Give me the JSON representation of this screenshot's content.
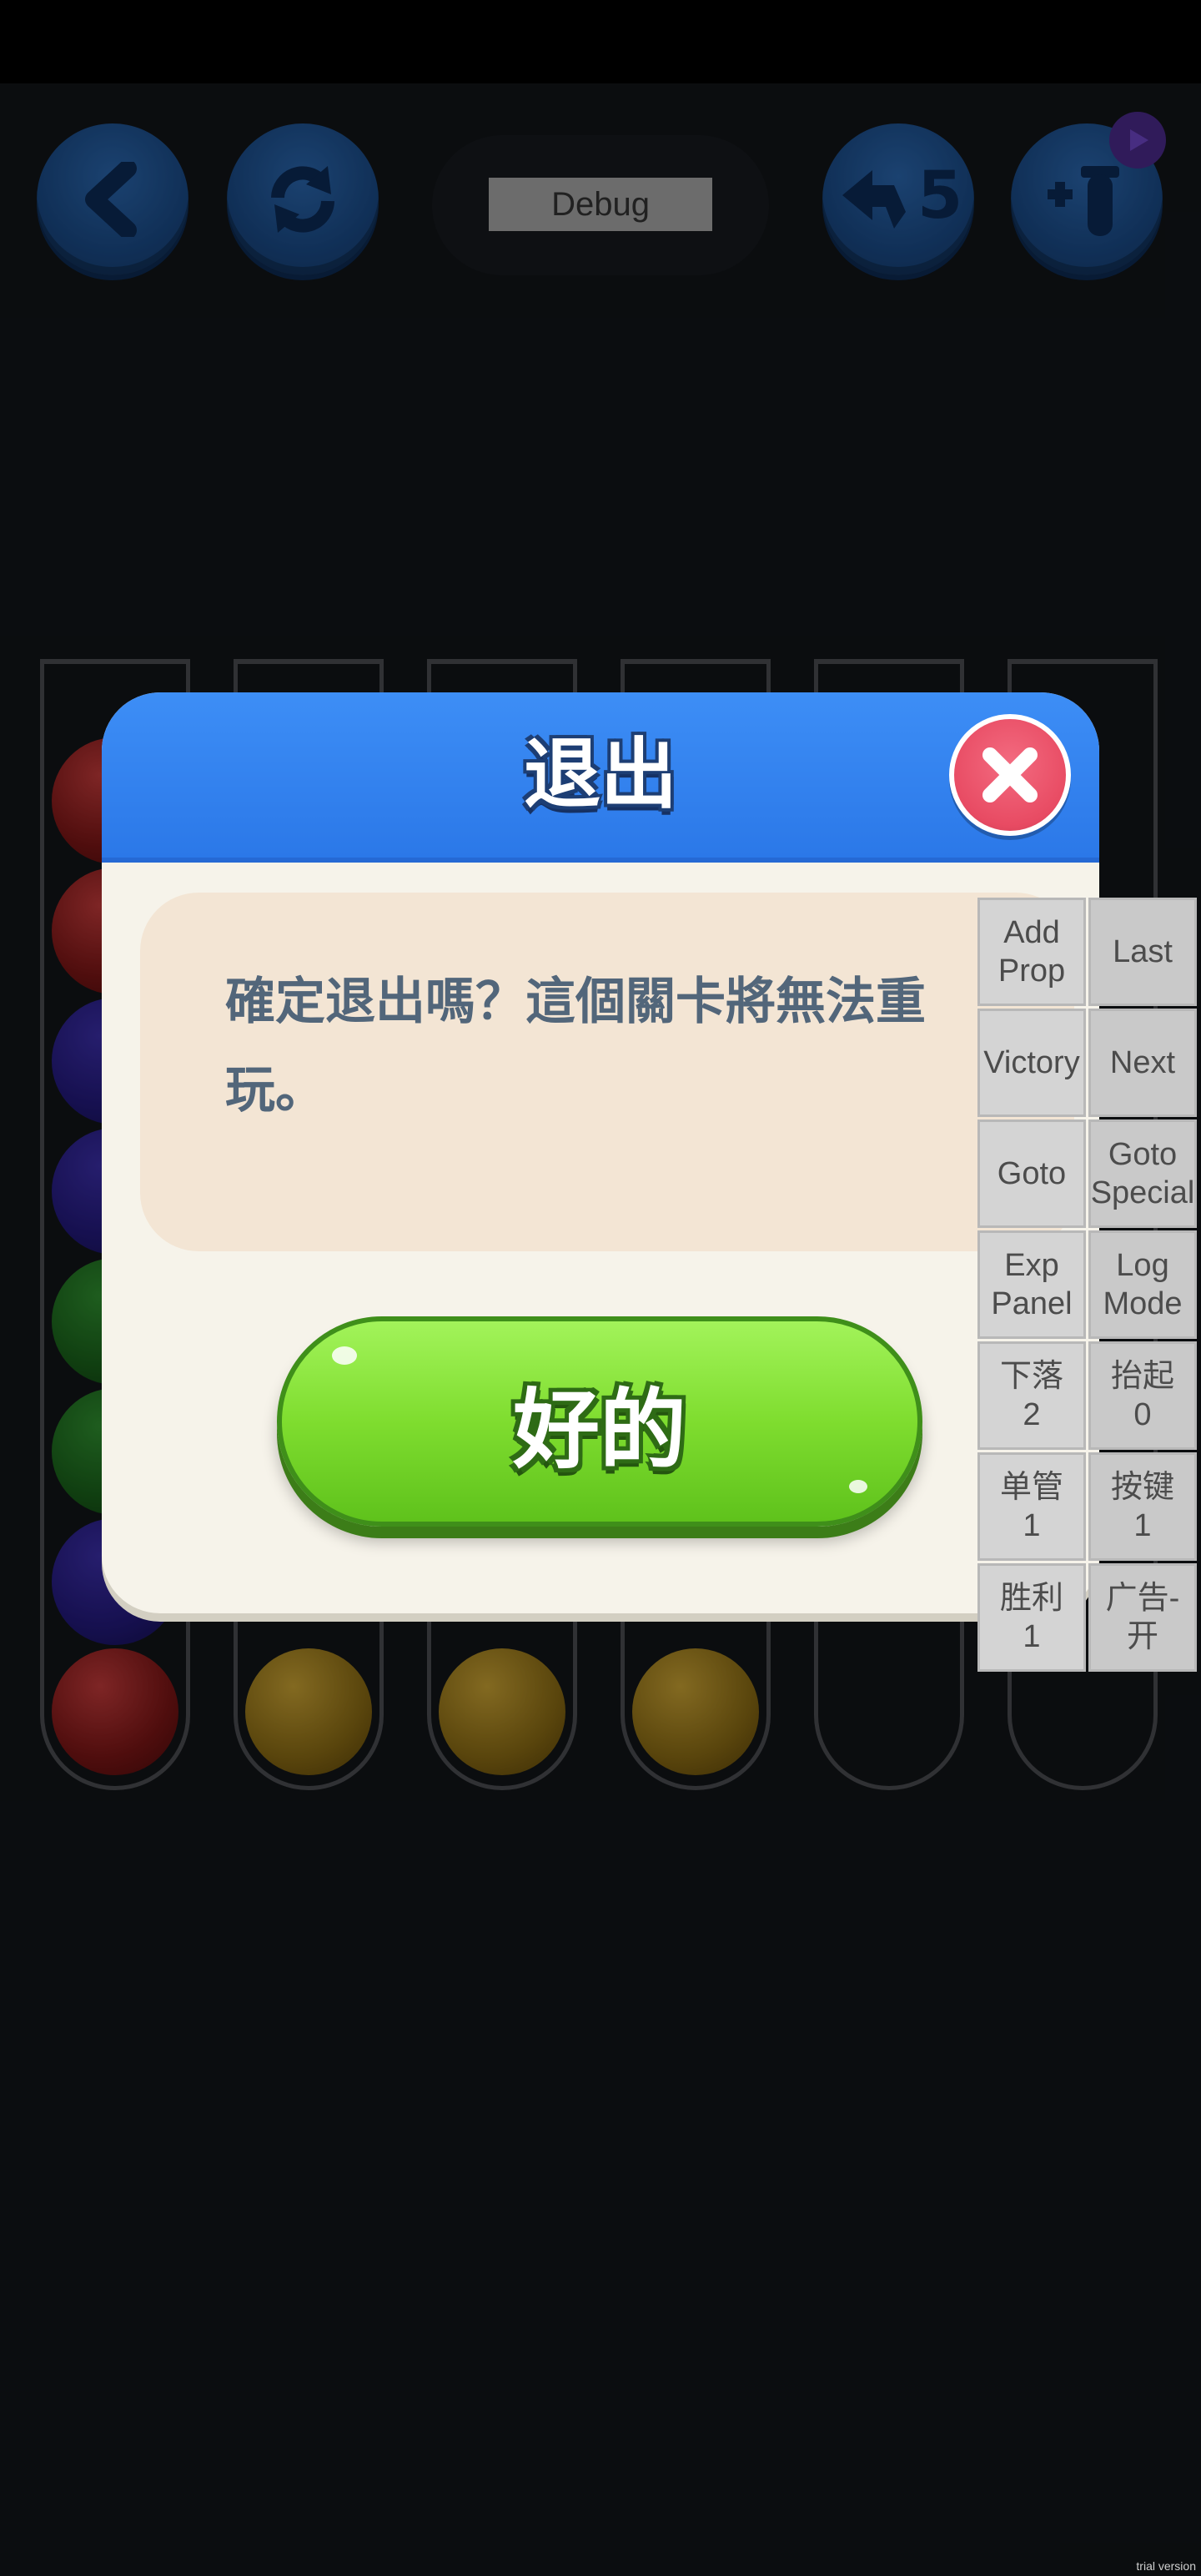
{
  "top_bar": {
    "back_icon": "chevron-left-icon",
    "restart_icon": "refresh-icon",
    "debug_label": "Debug",
    "undo_icon": "undo-arrow-icon",
    "undo_count": "5",
    "add_tube_icon": "add-tube-icon",
    "ad_badge_icon": "play-icon"
  },
  "tubes": [
    {
      "balls": [
        "red",
        "red",
        "blue",
        "blue",
        "green",
        "green",
        "blue",
        "red"
      ]
    },
    {
      "balls": [
        "yellow"
      ]
    },
    {
      "balls": [
        "yellow"
      ]
    },
    {
      "balls": [
        "yellow"
      ]
    },
    {
      "balls": []
    },
    {
      "balls": []
    }
  ],
  "dialog": {
    "title": "退出",
    "message": "確定退出嗎？這個關卡將無法重玩。",
    "ok_label": "好的",
    "close_icon": "close-icon"
  },
  "debug_panel": {
    "buttons": [
      [
        "Add\nProp",
        "Last"
      ],
      [
        "Victory",
        "Next"
      ],
      [
        "Goto",
        "Goto\nSpecial"
      ],
      [
        "Exp\nPanel",
        "Log\nMode"
      ],
      [
        "下落\n2",
        "抬起\n0"
      ],
      [
        "单管\n1",
        "按键\n1"
      ],
      [
        "胜利\n1",
        "广告-开"
      ]
    ]
  },
  "watermark": "trial version",
  "colors": {
    "dialog_header": "#2b78e8",
    "ok_button": "#7fdd2f",
    "close_button": "#e84b63",
    "message_text": "#52667a"
  }
}
